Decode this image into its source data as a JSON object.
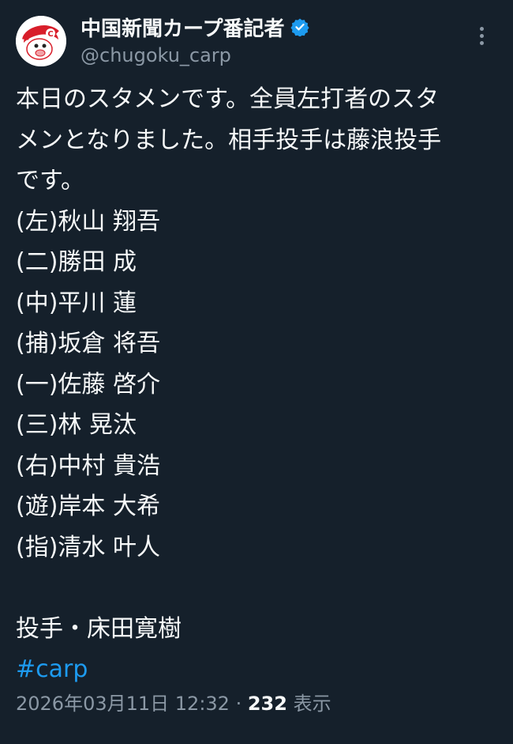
{
  "account": {
    "display_name": "中国新聞カープ番記者",
    "handle": "@chugoku_carp",
    "verified": true,
    "avatar_icon": "carp-mascot-avatar"
  },
  "tweet": {
    "intro_lines": [
      "本日のスタメンです。全員左打者のスタ",
      "メンとなりました。相手投手は藤浪投手",
      "です。"
    ],
    "lineup": [
      "(左)秋山 翔吾",
      "(二)勝田 成",
      "(中)平川 蓮",
      "(捕)坂倉 将吾",
      "(一)佐藤 啓介",
      "(三)林 晃汰",
      "(右)中村 貴浩",
      "(遊)岸本 大希",
      "(指)清水 叶人"
    ],
    "pitcher": "投手・床田寛樹",
    "hashtag": "#carp"
  },
  "meta": {
    "timestamp": "2026年03月11日 12:32",
    "separator": " · ",
    "views_count": "232",
    "views_label": " 表示"
  },
  "colors": {
    "background": "#15202b",
    "text": "#f7f9f9",
    "secondary": "#8b98a5",
    "accent": "#1d9bf0"
  }
}
